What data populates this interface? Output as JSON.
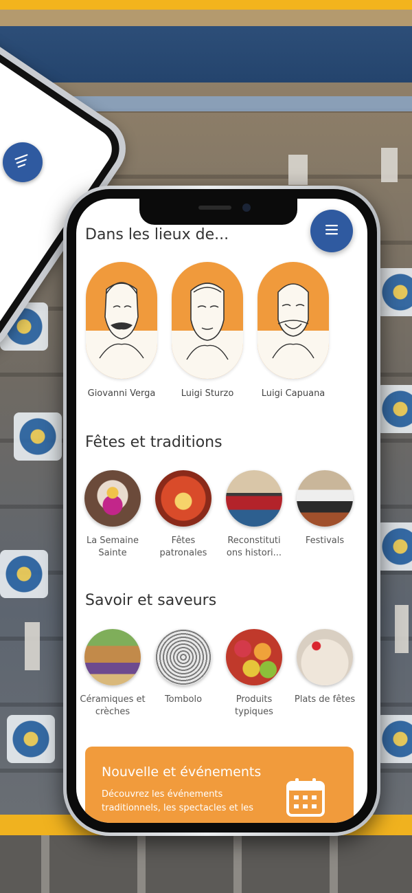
{
  "app": {
    "sections": {
      "places": {
        "title": "Dans les lieux de...",
        "people": [
          {
            "name": "Giovanni Verga"
          },
          {
            "name": "Luigi Sturzo"
          },
          {
            "name": "Luigi Capuana"
          }
        ]
      },
      "traditions": {
        "title": "Fêtes et traditions",
        "items": [
          {
            "label": "La Semaine Sainte"
          },
          {
            "label": "Fêtes patronales"
          },
          {
            "label": "Reconstituti ons histori..."
          },
          {
            "label": "Festivals"
          }
        ]
      },
      "knowledge": {
        "title": "Savoir et saveurs",
        "items": [
          {
            "label": "Céramiques et crèches"
          },
          {
            "label": "Tombolo"
          },
          {
            "label": "Produits typiques"
          },
          {
            "label": "Plats de fêtes"
          }
        ]
      }
    },
    "events_card": {
      "title": "Nouvelle et événements",
      "description": "Découvrez les événements traditionnels, les spectacles et les"
    }
  },
  "icons": {
    "menu": "hamburger-menu-icon",
    "calendar": "calendar-icon"
  },
  "colors": {
    "accent_orange": "#f09a3c",
    "primary_blue": "#2f5aa0"
  }
}
